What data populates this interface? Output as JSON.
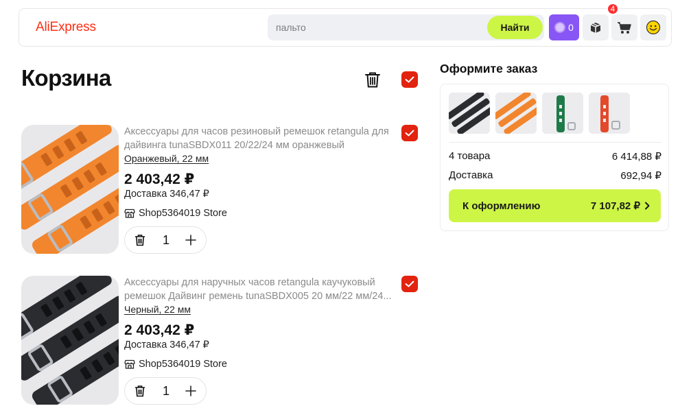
{
  "header": {
    "logo": "AliExpress",
    "search_placeholder": "пальто",
    "search_button": "Найти",
    "coins": "0",
    "cart_badge": "4",
    "colors": {
      "brand": "#ff2e14",
      "accent": "#cdf546",
      "coins": "#8856f4"
    }
  },
  "cart": {
    "title": "Корзина",
    "items": [
      {
        "title": "Аксессуары для часов резиновый ремешок retangula для дайвинга tunaSBDX011 20/22/24 мм оранжевый",
        "variant": "Оранжевый, 22 мм",
        "price": "2 403,42 ₽",
        "delivery": "Доставка 346,47 ₽",
        "shop": "Shop5364019 Store",
        "quantity": "1",
        "strap_color": "#f2862e"
      },
      {
        "title": "Аксессуары для наручных часов retangula каучуковый ремешок Дайвинг ремень tunaSBDX005 20 мм/22 мм/24...",
        "variant": "Черный, 22 мм",
        "price": "2 403,42 ₽",
        "delivery": "Доставка 346,47 ₽",
        "shop": "Shop5364019 Store",
        "quantity": "1",
        "strap_color": "#2a2c30"
      }
    ]
  },
  "summary": {
    "title": "Оформите заказ",
    "items_label": "4 товара",
    "items_total": "6 414,88 ₽",
    "delivery_label": "Доставка",
    "delivery_total": "692,94 ₽",
    "checkout_label": "К оформлению",
    "checkout_total": "7 107,82 ₽",
    "thumb_colors": [
      "#2a2c30",
      "#f2862e",
      "#1f7a4a",
      "#e24a2a"
    ]
  }
}
